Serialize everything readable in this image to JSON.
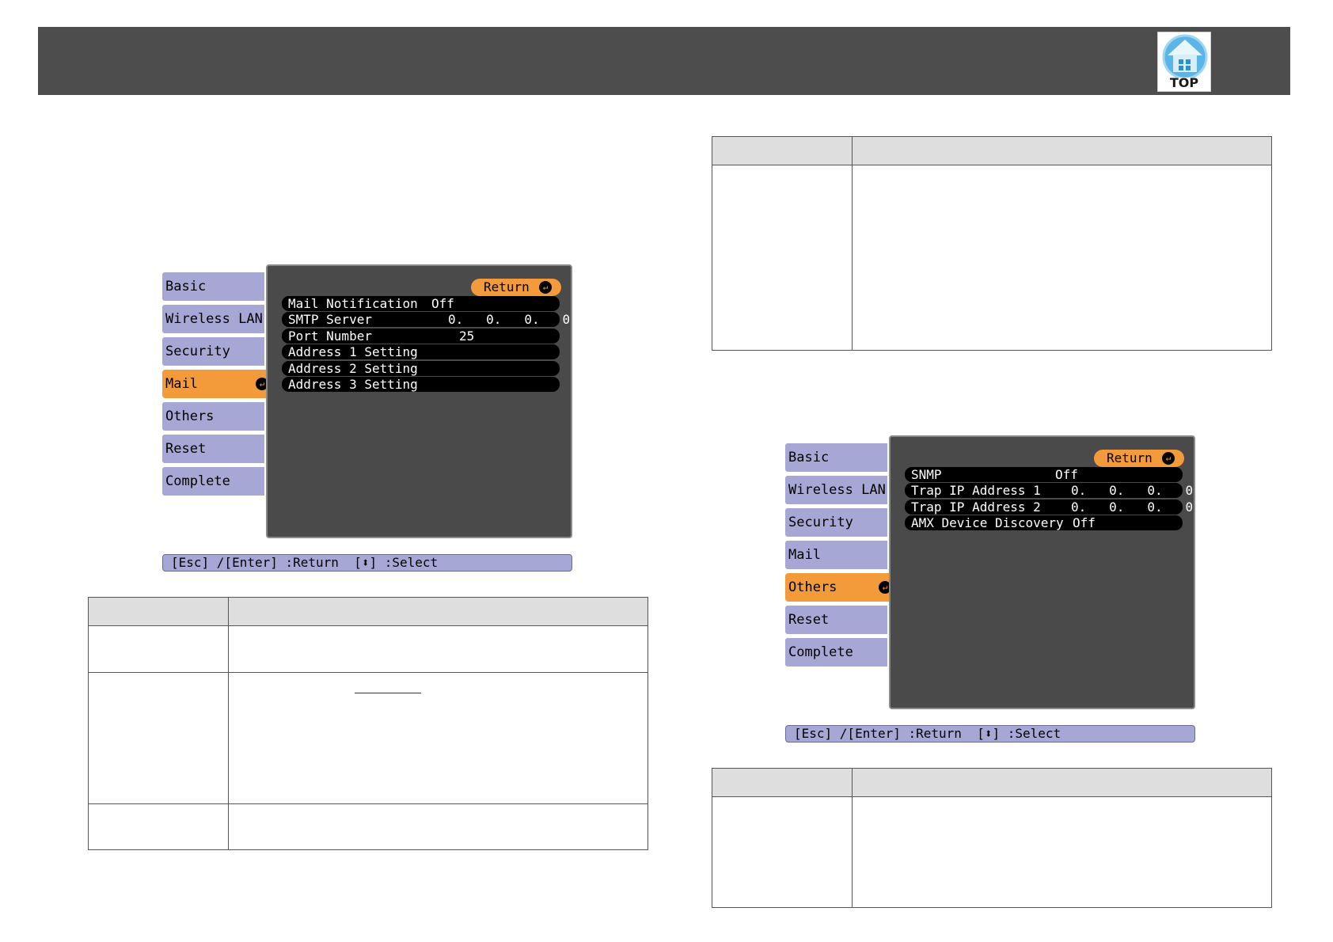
{
  "header": {
    "top_label": "TOP"
  },
  "menu_left": {
    "tabs": [
      "Basic",
      "Wireless LAN",
      "Security",
      "Mail",
      "Others",
      "Reset",
      "Complete"
    ],
    "active_tab": "Mail",
    "return_label": "Return",
    "rows": [
      {
        "label": "Mail Notification",
        "value": "Off"
      },
      {
        "label": "SMTP Server",
        "value": "0.   0.   0.   0"
      },
      {
        "label": "Port Number",
        "value": "25"
      },
      {
        "label": "Address 1 Setting",
        "value": ""
      },
      {
        "label": "Address 2 Setting",
        "value": ""
      },
      {
        "label": "Address 3 Setting",
        "value": ""
      }
    ],
    "footer": "[Esc] /[Enter] :Return  [⬍] :Select"
  },
  "menu_right": {
    "tabs": [
      "Basic",
      "Wireless LAN",
      "Security",
      "Mail",
      "Others",
      "Reset",
      "Complete"
    ],
    "active_tab": "Others",
    "return_label": "Return",
    "rows": [
      {
        "label": "SNMP",
        "value": "Off"
      },
      {
        "label": "Trap IP Address 1",
        "value": "0.   0.   0.   0"
      },
      {
        "label": "Trap IP Address 2",
        "value": "0.   0.   0.   0"
      },
      {
        "label": "AMX Device Discovery",
        "value": "Off"
      }
    ],
    "footer": "[Esc] /[Enter] :Return  [⬍] :Select"
  },
  "colors": {
    "header": "#4d4d4d",
    "tab": "#a7a7d6",
    "active": "#f39a3a",
    "panel": "#4a4a4a",
    "table_header": "#dedede"
  }
}
